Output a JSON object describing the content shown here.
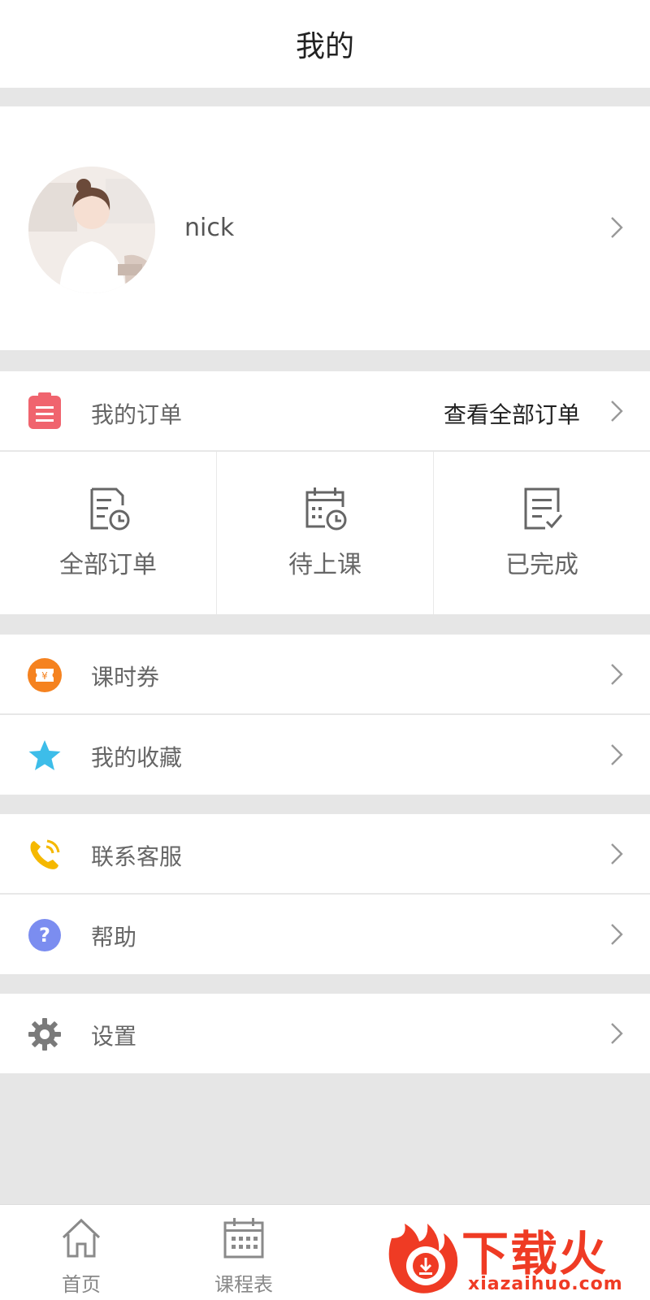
{
  "header": {
    "title": "我的"
  },
  "profile": {
    "name": "nick"
  },
  "orders": {
    "label": "我的订单",
    "view_all": "查看全部订单",
    "items": [
      {
        "label": "全部订单",
        "icon": "order-list-clock-icon"
      },
      {
        "label": "待上课",
        "icon": "calendar-clock-icon"
      },
      {
        "label": "已完成",
        "icon": "document-check-icon"
      }
    ]
  },
  "menu": {
    "coupons": "课时券",
    "favorites": "我的收藏",
    "contact": "联系客服",
    "help": "帮助",
    "settings": "设置"
  },
  "tabbar": {
    "home": "首页",
    "schedule": "课程表"
  },
  "watermark": {
    "text": "下载火",
    "url": "xiazaihuo.com"
  },
  "colors": {
    "order_icon": "#f0646e",
    "coupon_icon": "#f5821f",
    "star_icon": "#3dbde9",
    "phone_icon": "#f5b800",
    "help_icon": "#7b8df0",
    "settings_icon": "#7a7a7a",
    "brand_red": "#ef3b24"
  }
}
